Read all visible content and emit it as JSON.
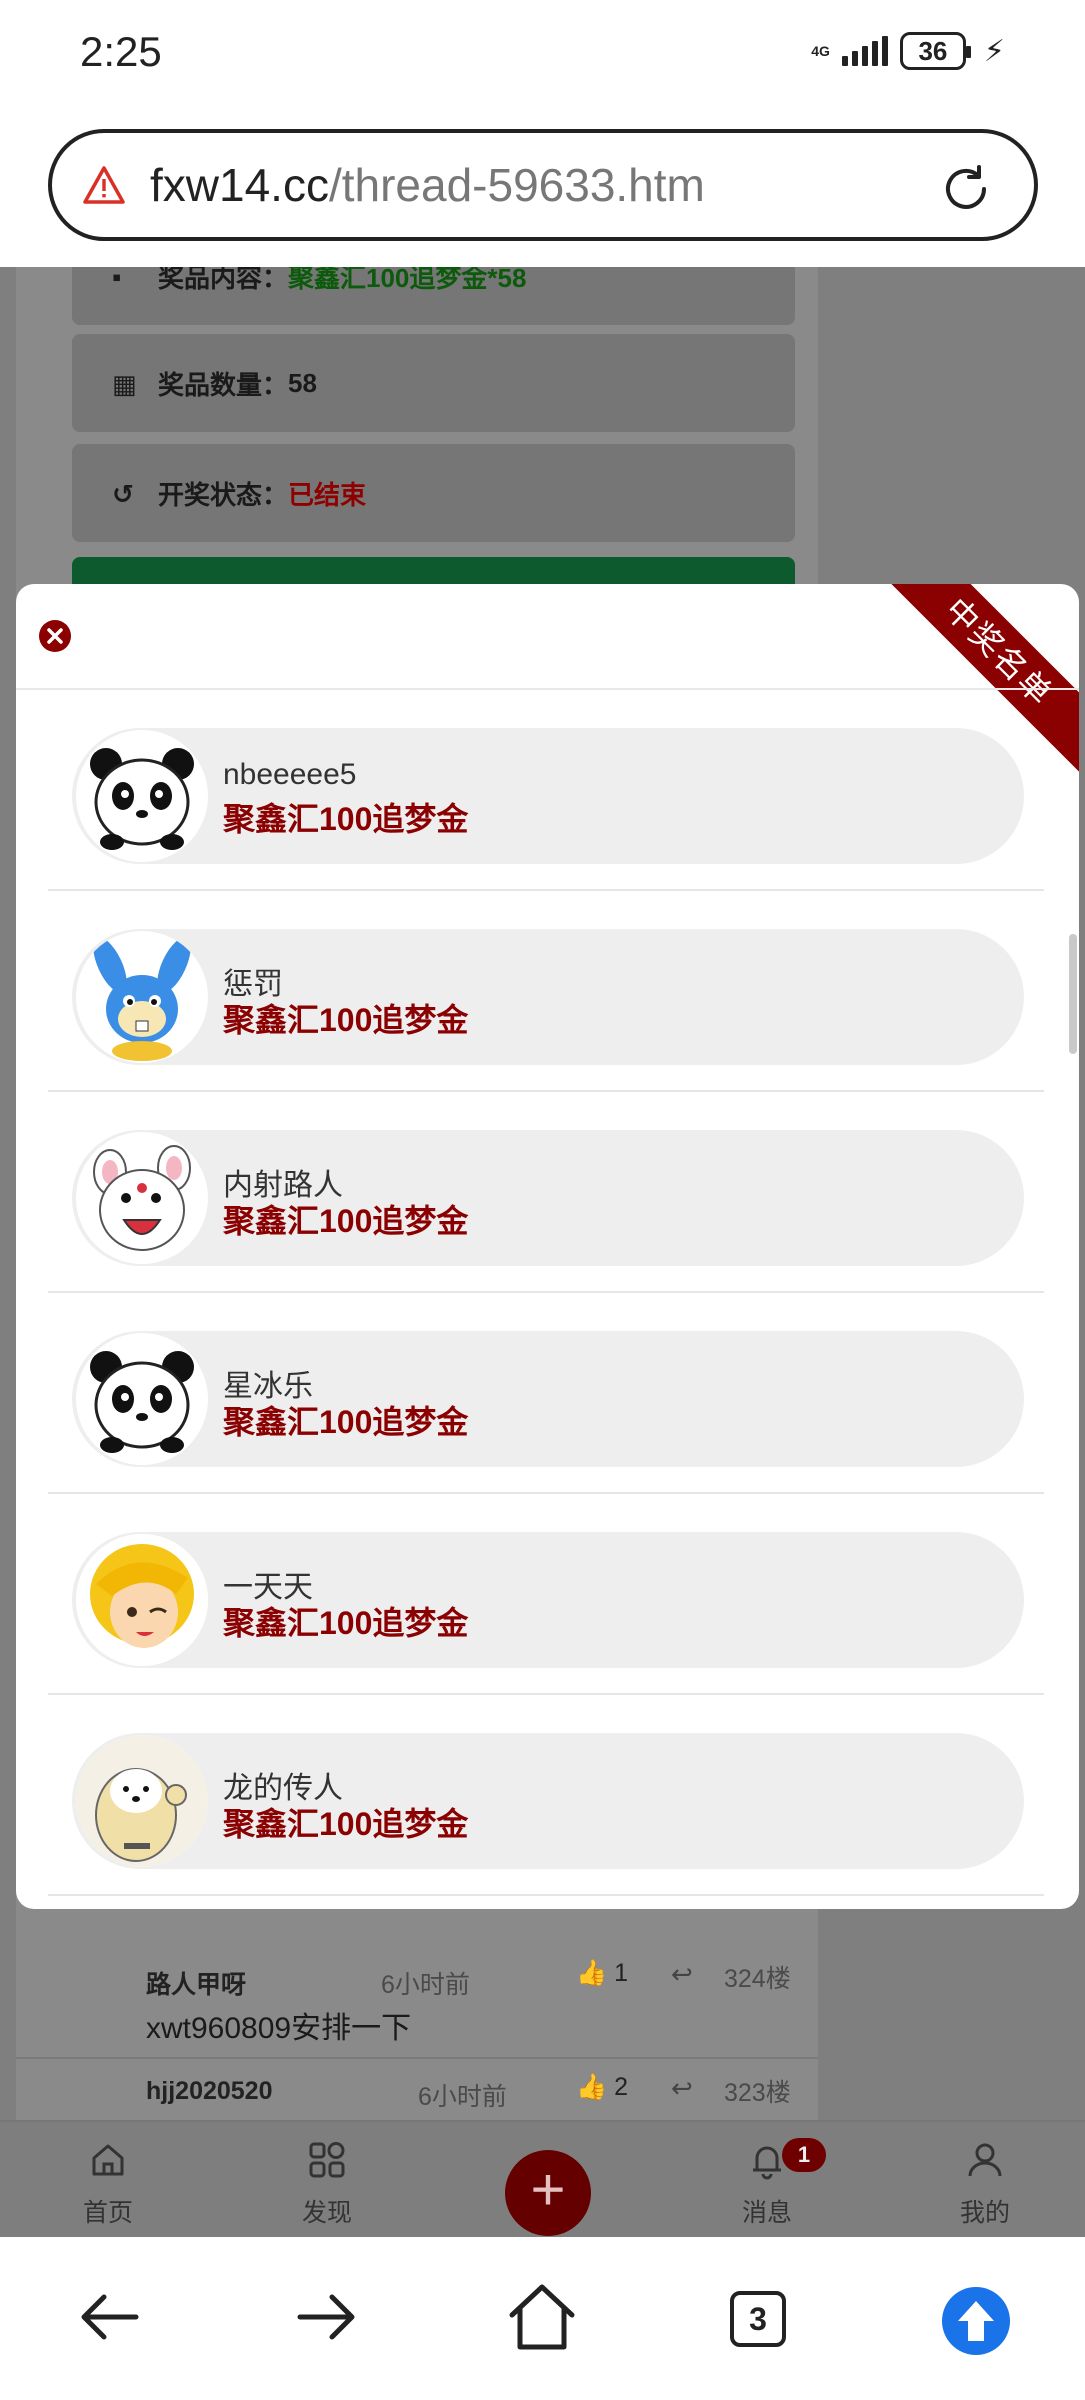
{
  "status_bar": {
    "time": "2:25",
    "network": "4G",
    "battery": "36"
  },
  "url_bar": {
    "domain": "fxw14.cc",
    "path": "/thread-59633.htm"
  },
  "background_page": {
    "info_rows": [
      {
        "label": "奖品内容：",
        "value": "聚鑫汇100追梦金*58",
        "icon": "gift-icon"
      },
      {
        "label": "奖品数量：",
        "value": "58",
        "icon": "boxes-icon"
      },
      {
        "label": "开奖状态：",
        "value": "已结束",
        "icon": "history-icon"
      }
    ],
    "comments": [
      {
        "user": "路人甲呀",
        "time": "6小时前",
        "likes": "1",
        "floor": "324楼",
        "text": "xwt960809安排一下"
      },
      {
        "user": "hjj2020520",
        "time": "6小时前",
        "likes": "2",
        "floor": "323楼",
        "text": ""
      }
    ]
  },
  "bottom_nav": {
    "items": [
      {
        "label": "首页",
        "icon": "home-icon"
      },
      {
        "label": "发现",
        "icon": "grid-icon"
      },
      {
        "label": "消息",
        "icon": "bell-icon"
      },
      {
        "label": "我的",
        "icon": "user-icon"
      }
    ],
    "message_badge": "1"
  },
  "modal": {
    "ribbon": "中奖名单",
    "winners": [
      {
        "name": "nbeeeee5",
        "prize": "聚鑫汇100追梦金",
        "avatar": "panda"
      },
      {
        "name": "惩罚",
        "prize": "聚鑫汇100追梦金",
        "avatar": "rabbit"
      },
      {
        "name": "内射路人",
        "prize": "聚鑫汇100追梦金",
        "avatar": "white-bunny"
      },
      {
        "name": "星冰乐",
        "prize": "聚鑫汇100追梦金",
        "avatar": "panda"
      },
      {
        "name": "一天天",
        "prize": "聚鑫汇100追梦金",
        "avatar": "blonde-girl"
      },
      {
        "name": "龙的传人",
        "prize": "聚鑫汇100追梦金",
        "avatar": "shiba"
      }
    ]
  },
  "browser_bar": {
    "tab_count": "3"
  },
  "colors": {
    "accent_red": "#8b0000",
    "browser_blue": "#1a73e8"
  }
}
